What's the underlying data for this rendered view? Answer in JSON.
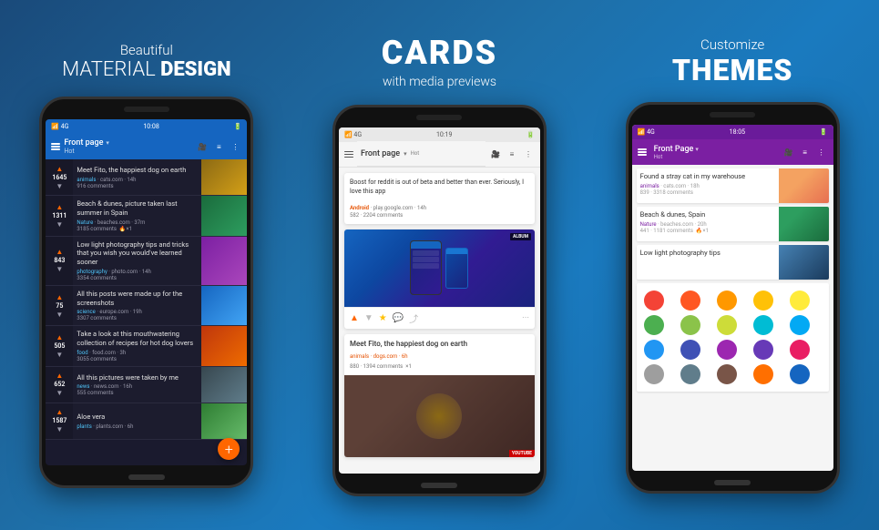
{
  "columns": [
    {
      "id": "col1",
      "header": {
        "line1": "Beautiful",
        "line2": "MATERIAL DESIGN",
        "line2_light": "MATERIAL ",
        "line2_bold": "DESIGN"
      },
      "phone": {
        "status_time": "10:08",
        "appbar_title": "Front page",
        "appbar_subtitle": "Hot",
        "feed": [
          {
            "votes": "1645",
            "title": "Meet Fito, the happiest dog on earth",
            "subreddit": "animals",
            "domain": "cats.com",
            "age": "14h",
            "comments": "916 comments",
            "thumb_class": "thumb-dog"
          },
          {
            "votes": "1311",
            "title": "Beach & dunes, picture taken last summer in Spain",
            "subreddit": "Nature",
            "domain": "beaches.com",
            "age": "37m",
            "comments": "3185 comments",
            "thumb_class": "thumb-beach"
          },
          {
            "votes": "843",
            "title": "Low light photography tips and tricks that you wish you would've learned sooner",
            "subreddit": "photography",
            "domain": "photo.com",
            "age": "14h",
            "comments": "3354 comments",
            "thumb_class": "thumb-photo"
          },
          {
            "votes": "75",
            "title": "All this posts were made up for the screenshots",
            "subreddit": "science",
            "domain": "europe.com",
            "age": "19h",
            "comments": "3307 comments",
            "thumb_class": "thumb-science"
          },
          {
            "votes": "505",
            "title": "Take a look at this mouthwatering collection of recipes for hot dog lovers",
            "subreddit": "food",
            "domain": "food.com",
            "age": "3h",
            "comments": "3055 comments",
            "thumb_class": "thumb-food"
          },
          {
            "votes": "652",
            "title": "All this pictures were taken by me",
            "subreddit": "news",
            "domain": "news.com",
            "age": "16h",
            "comments": "555 comments",
            "thumb_class": "thumb-news"
          },
          {
            "votes": "1587",
            "title": "Aloe vera",
            "subreddit": "plants",
            "domain": "plants.com",
            "age": "6h",
            "comments": "",
            "thumb_class": "thumb-aloe"
          }
        ]
      }
    },
    {
      "id": "col2",
      "header": {
        "line1": "CARDS",
        "line2": "with media previews"
      },
      "phone": {
        "status_time": "10:19",
        "appbar_title": "Front page",
        "appbar_subtitle": "Hot",
        "card1": {
          "text": "Boost for reddit is out of beta and better than ever. Seriously, I love this app",
          "subreddit": "Android",
          "domain": "play.google.com",
          "age": "14h",
          "votes": "582",
          "comments": "2204 comments"
        },
        "card2_badge": "ALBUM",
        "card3": {
          "title": "Meet Fito, the happiest dog on earth",
          "subreddit": "animals",
          "domain": "dogs.com",
          "age": "6h",
          "votes": "880",
          "comments": "1394 comments"
        },
        "card4_badge": "YOUTUBE"
      }
    },
    {
      "id": "col3",
      "header": {
        "line1": "Customize",
        "line2": "THEMES"
      },
      "phone": {
        "status_time": "18:05",
        "appbar_title": "Front Page",
        "appbar_subtitle": "Hot",
        "feed": [
          {
            "votes": "839",
            "title": "Found a stray cat in my warehouse",
            "subreddit": "animals",
            "domain": "cats.com",
            "age": "18h",
            "comments": "3318 comments",
            "thumb_class": "thumb3-cat"
          },
          {
            "votes": "441",
            "title": "Beach & dunes, Spain",
            "subreddit": "Nature",
            "domain": "beaches.com",
            "age": "20h",
            "comments": "1181 comments",
            "thumb_class": "thumb3-beach"
          },
          {
            "votes": "",
            "title": "Low light photography tips",
            "subreddit": "",
            "domain": "",
            "age": "",
            "comments": "",
            "thumb_class": "thumb3-photo"
          }
        ],
        "color_circles": [
          "#F44336",
          "#FF5722",
          "#FF9800",
          "#FFC107",
          "#FFEB3B",
          "#4CAF50",
          "#8BC34A",
          "#CDDC39",
          "#00BCD4",
          "#03A9F4",
          "#2196F3",
          "#3F51B5",
          "#9C27B0",
          "#673AB7",
          "#E91E63",
          "#9E9E9E",
          "#607D8B",
          "#795548",
          "#FF6F00",
          "#1565C0"
        ]
      }
    }
  ]
}
